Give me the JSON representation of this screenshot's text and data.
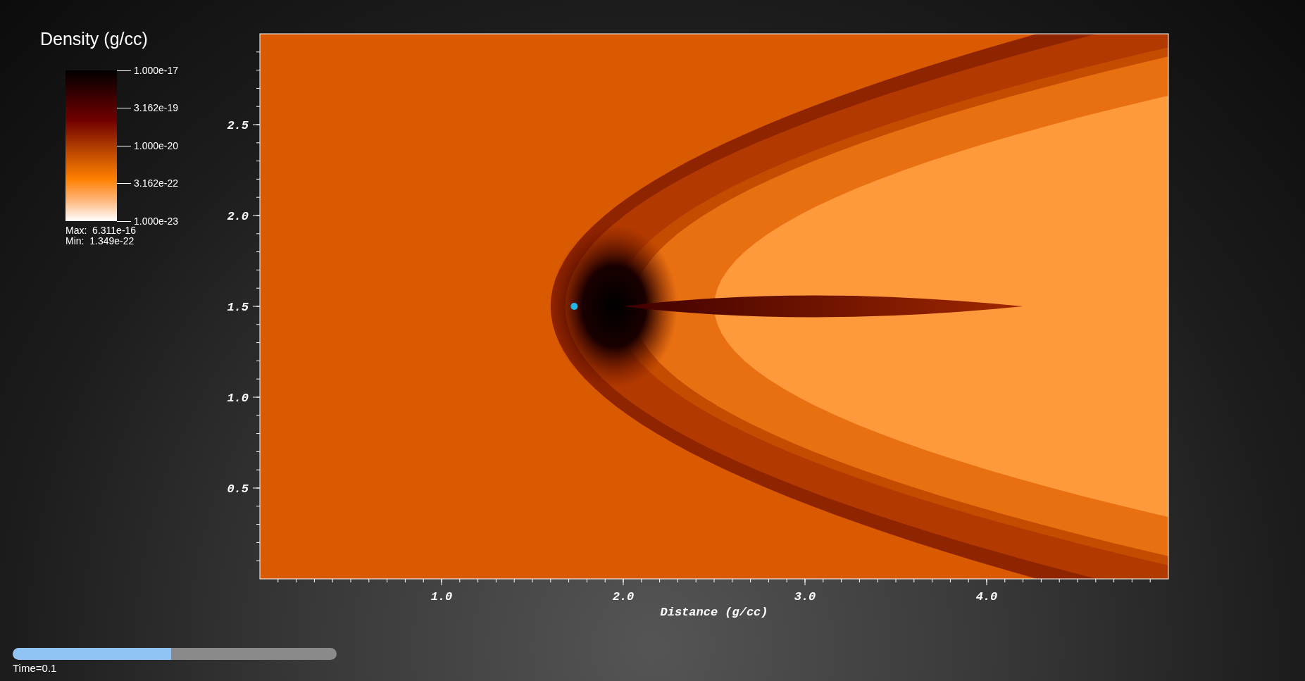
{
  "legend": {
    "title": "Density (g/cc)",
    "ticks": [
      "1.000e-17",
      "3.162e-19",
      "1.000e-20",
      "3.162e-22",
      "1.000e-23"
    ],
    "max": "Max:  6.311e-16",
    "min": "Min:  1.349e-22"
  },
  "plot": {
    "y_ticks": [
      "2.5",
      "2.0",
      "1.5",
      "1.0",
      "0.5"
    ],
    "x_ticks": [
      "1.0",
      "2.0",
      "3.0",
      "4.0"
    ],
    "xlabel": "Distance (g/cc)"
  },
  "time_slider": {
    "level": 0.49,
    "label": "Time=0.1"
  }
}
